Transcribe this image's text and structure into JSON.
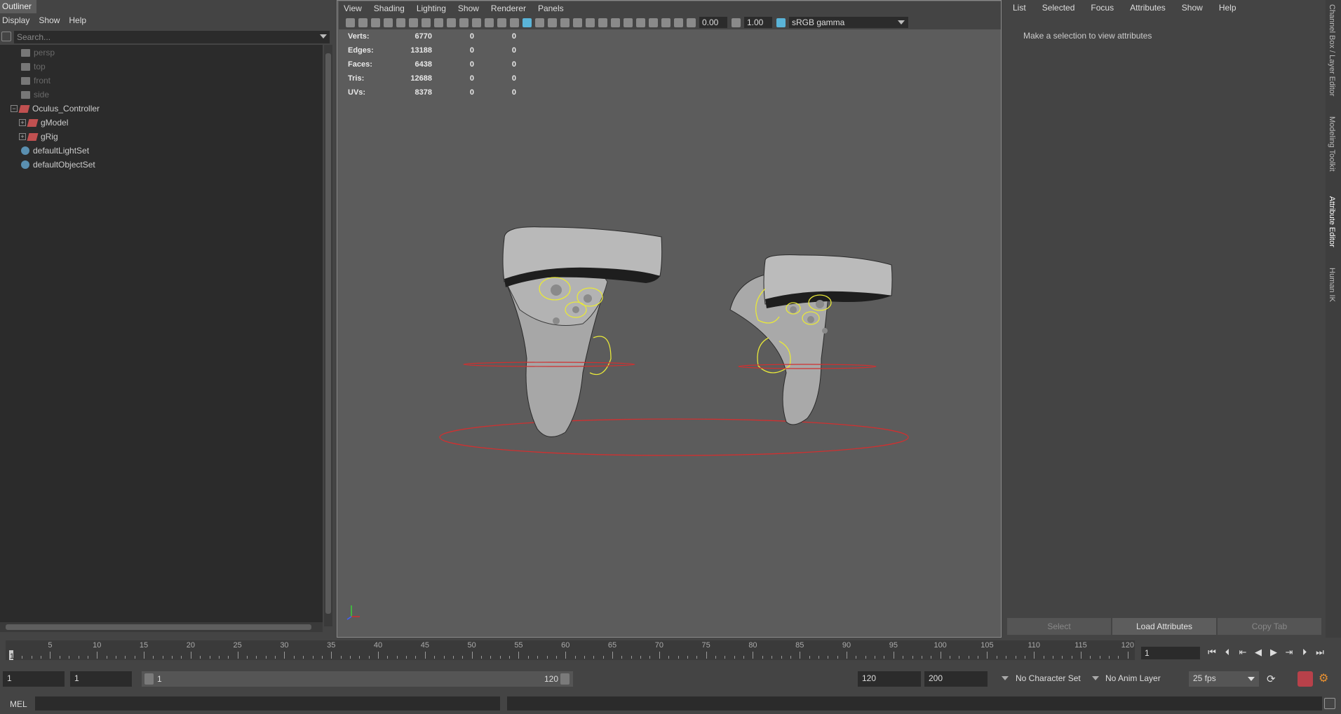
{
  "outliner": {
    "title": "Outliner",
    "menu": [
      "Display",
      "Show",
      "Help"
    ],
    "search_placeholder": "Search...",
    "items": [
      {
        "label": "persp",
        "type": "camera",
        "dimmed": true
      },
      {
        "label": "top",
        "type": "camera",
        "dimmed": true
      },
      {
        "label": "front",
        "type": "camera",
        "dimmed": true
      },
      {
        "label": "side",
        "type": "camera",
        "dimmed": true
      },
      {
        "label": "Oculus_Controller",
        "type": "group"
      },
      {
        "label": "gModel",
        "type": "group"
      },
      {
        "label": "gRig",
        "type": "group"
      },
      {
        "label": "defaultLightSet",
        "type": "set"
      },
      {
        "label": "defaultObjectSet",
        "type": "set"
      }
    ]
  },
  "viewport": {
    "menu": [
      "View",
      "Shading",
      "Lighting",
      "Show",
      "Renderer",
      "Panels"
    ],
    "toolbar": {
      "exposure": "0.00",
      "gamma": "1.00",
      "colorspace": "sRGB gamma"
    },
    "hud": [
      {
        "label": "Verts:",
        "v1": "6770",
        "v2": "0",
        "v3": "0"
      },
      {
        "label": "Edges:",
        "v1": "13188",
        "v2": "0",
        "v3": "0"
      },
      {
        "label": "Faces:",
        "v1": "6438",
        "v2": "0",
        "v3": "0"
      },
      {
        "label": "Tris:",
        "v1": "12688",
        "v2": "0",
        "v3": "0"
      },
      {
        "label": "UVs:",
        "v1": "8378",
        "v2": "0",
        "v3": "0"
      }
    ]
  },
  "attribute_editor": {
    "menu": [
      "List",
      "Selected",
      "Focus",
      "Attributes",
      "Show",
      "Help"
    ],
    "message": "Make a selection to view attributes",
    "buttons": {
      "select": "Select",
      "load": "Load Attributes",
      "copy": "Copy Tab"
    }
  },
  "side_tabs": [
    "Channel Box / Layer Editor",
    "Modeling Toolkit",
    "Attribute Editor",
    "Human IK"
  ],
  "timeline": {
    "ticks": [
      "5",
      "10",
      "15",
      "20",
      "25",
      "30",
      "35",
      "40",
      "45",
      "50",
      "55",
      "60",
      "65",
      "70",
      "75",
      "80",
      "85",
      "90",
      "95",
      "100",
      "105",
      "110",
      "115",
      "120"
    ],
    "current_marker": "1",
    "current_frame": "1"
  },
  "range": {
    "start": "1",
    "playback_start": "1",
    "slider_start": "1",
    "slider_end": "120",
    "playback_end": "120",
    "end": "200",
    "character_set": "No Character Set",
    "anim_layer": "No Anim Layer",
    "fps": "25 fps"
  },
  "command": {
    "label": "MEL"
  },
  "colors": {
    "accent": "#5ab4d8",
    "selection_yellow": "#e8e83a",
    "rig_red": "#d03030",
    "panel": "#444444",
    "field": "#2b2b2b"
  }
}
